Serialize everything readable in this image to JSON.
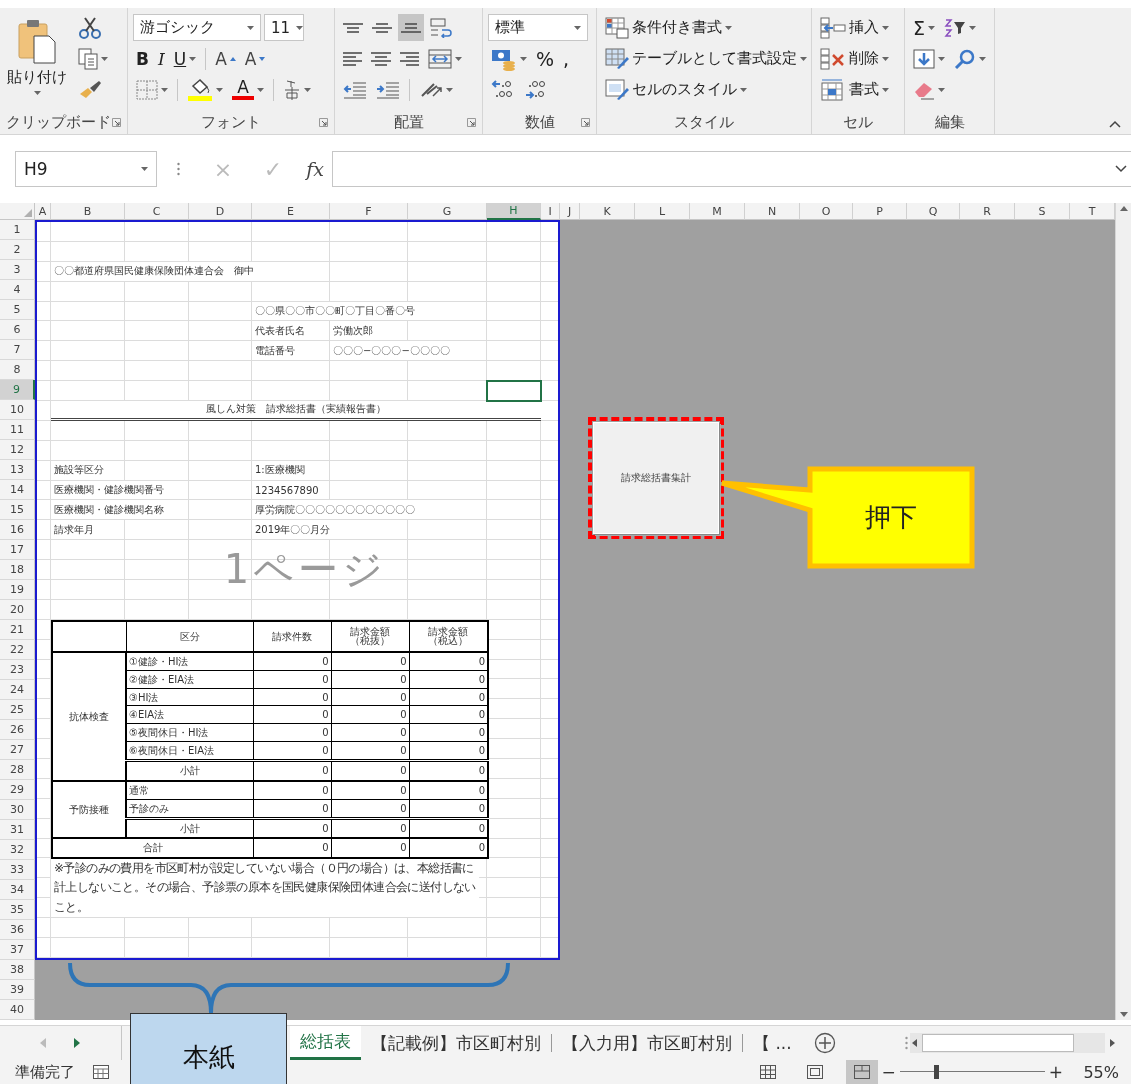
{
  "ribbon": {
    "clipboard": {
      "label": "クリップボード",
      "paste": "貼り付け"
    },
    "font": {
      "label": "フォント",
      "name": "游ゴシック",
      "size": "11",
      "bold": "B",
      "italic": "I",
      "underline": "U",
      "grow": "A",
      "shrink": "A",
      "color_letter": "A"
    },
    "alignment": {
      "label": "配置",
      "vertical": [
        {
          "kind": "top",
          "selected": false
        },
        {
          "kind": "middle",
          "selected": false
        },
        {
          "kind": "bottom",
          "selected": true
        }
      ]
    },
    "number": {
      "label": "数値",
      "format": "標準",
      "percent": "%",
      "comma": ","
    },
    "styles": {
      "label": "スタイル",
      "commands": [
        {
          "kind": "conditional",
          "label": "条件付き書式"
        },
        {
          "kind": "table",
          "label": "テーブルとして書式設定"
        },
        {
          "kind": "cell",
          "label": "セルのスタイル"
        }
      ]
    },
    "cells": {
      "label": "セル",
      "commands": [
        {
          "kind": "insert",
          "label": "挿入"
        },
        {
          "kind": "delete",
          "label": "削除"
        },
        {
          "kind": "format",
          "label": "書式"
        }
      ]
    },
    "editing": {
      "label": "編集",
      "sum": "Σ"
    }
  },
  "formula_bar": {
    "name_box": "H9",
    "cancel": {
      "label": "×",
      "disabled": true
    },
    "enter": {
      "label": "✓",
      "disabled": true
    },
    "function": "fx"
  },
  "sheet": {
    "column_headers": [
      {
        "label": "A",
        "selected": false
      },
      {
        "label": "B",
        "selected": false
      },
      {
        "label": "C",
        "selected": false
      },
      {
        "label": "D",
        "selected": false
      },
      {
        "label": "E",
        "selected": false
      },
      {
        "label": "F",
        "selected": false
      },
      {
        "label": "G",
        "selected": false
      },
      {
        "label": "H",
        "selected": true
      },
      {
        "label": "I",
        "selected": false
      },
      {
        "label": "J",
        "selected": false
      },
      {
        "label": "K",
        "selected": false
      },
      {
        "label": "L",
        "selected": false
      },
      {
        "label": "M",
        "selected": false
      },
      {
        "label": "N",
        "selected": false
      },
      {
        "label": "O",
        "selected": false
      },
      {
        "label": "P",
        "selected": false
      },
      {
        "label": "Q",
        "selected": false
      },
      {
        "label": "R",
        "selected": false
      },
      {
        "label": "S",
        "selected": false
      },
      {
        "label": "T",
        "selected": false
      }
    ],
    "row_headers": [
      {
        "label": "1",
        "selected": false
      },
      {
        "label": "2",
        "selected": false
      },
      {
        "label": "3",
        "selected": false
      },
      {
        "label": "4",
        "selected": false
      },
      {
        "label": "5",
        "selected": false
      },
      {
        "label": "6",
        "selected": false
      },
      {
        "label": "7",
        "selected": false
      },
      {
        "label": "8",
        "selected": false
      },
      {
        "label": "9",
        "selected": true
      },
      {
        "label": "10",
        "selected": false
      },
      {
        "label": "11",
        "selected": false
      },
      {
        "label": "12",
        "selected": false
      },
      {
        "label": "13",
        "selected": false
      },
      {
        "label": "14",
        "selected": false
      },
      {
        "label": "15",
        "selected": false
      },
      {
        "label": "16",
        "selected": false
      },
      {
        "label": "17",
        "selected": false
      },
      {
        "label": "18",
        "selected": false
      },
      {
        "label": "19",
        "selected": false
      },
      {
        "label": "20",
        "selected": false
      },
      {
        "label": "21",
        "selected": false
      },
      {
        "label": "22",
        "selected": false
      },
      {
        "label": "23",
        "selected": false
      },
      {
        "label": "24",
        "selected": false
      },
      {
        "label": "25",
        "selected": false
      },
      {
        "label": "26",
        "selected": false
      },
      {
        "label": "27",
        "selected": false
      },
      {
        "label": "28",
        "selected": false
      },
      {
        "label": "29",
        "selected": false
      },
      {
        "label": "30",
        "selected": false
      },
      {
        "label": "31",
        "selected": false
      },
      {
        "label": "32",
        "selected": false
      },
      {
        "label": "33",
        "selected": false
      },
      {
        "label": "34",
        "selected": false
      },
      {
        "label": "35",
        "selected": false
      },
      {
        "label": "36",
        "selected": false
      },
      {
        "label": "37",
        "selected": false
      },
      {
        "label": "38",
        "selected": false
      },
      {
        "label": "39",
        "selected": false
      },
      {
        "label": "40",
        "selected": false
      }
    ],
    "addressee": "〇〇都道府県国民健康保険団体連合会　御中",
    "address": "〇〇県〇〇市〇〇町〇丁目〇番〇号",
    "representative": {
      "label": "代表者氏名",
      "value": "労働次郎"
    },
    "phone": {
      "label": "電話番号",
      "value": "〇〇〇−〇〇〇−〇〇〇〇"
    },
    "title": "風しん対策　請求総括書（実績報告書）",
    "fields": [
      {
        "label": "施設等区分",
        "value": "1:医療機関"
      },
      {
        "label": "医療機関・健診機関番号",
        "value": "1234567890"
      },
      {
        "label": "医療機関・健診機関名称",
        "value": "厚労病院〇〇〇〇〇〇〇〇〇〇〇〇"
      },
      {
        "label": "請求年月",
        "value": "2019年〇〇月分"
      }
    ],
    "page_label": "1ページ",
    "table": {
      "headers": [
        [
          "区分"
        ],
        [
          "請求件数"
        ],
        [
          "請求金額",
          "（税抜）"
        ],
        [
          "請求金額",
          "（税込）"
        ]
      ],
      "groups": [
        {
          "name": "抗体検査",
          "rows": [
            {
              "kind": "item",
              "label": "①健診・HI法",
              "values": [
                "0",
                "0",
                "0"
              ]
            },
            {
              "kind": "item",
              "label": "②健診・EIA法",
              "values": [
                "0",
                "0",
                "0"
              ]
            },
            {
              "kind": "item",
              "label": "③HI法",
              "values": [
                "0",
                "0",
                "0"
              ]
            },
            {
              "kind": "item",
              "label": "④EIA法",
              "values": [
                "0",
                "0",
                "0"
              ]
            },
            {
              "kind": "item",
              "label": "⑤夜間休日・HI法",
              "values": [
                "0",
                "0",
                "0"
              ]
            },
            {
              "kind": "item",
              "label": "⑥夜間休日・EIA法",
              "values": [
                "0",
                "0",
                "0"
              ]
            },
            {
              "kind": "subtotal",
              "label": "小計",
              "values": [
                "0",
                "0",
                "0"
              ]
            }
          ]
        },
        {
          "name": "予防接種",
          "rows": [
            {
              "kind": "item",
              "label": "通常",
              "values": [
                "0",
                "0",
                "0"
              ]
            },
            {
              "kind": "item",
              "label": "予診のみ",
              "values": [
                "0",
                "0",
                "0"
              ]
            },
            {
              "kind": "subtotal",
              "label": "小計",
              "values": [
                "0",
                "0",
                "0"
              ]
            }
          ]
        }
      ],
      "total": {
        "label": "合計",
        "values": [
          "0",
          "0",
          "0"
        ]
      }
    },
    "note": "※予診のみの費用を市区町村が設定していない場合（０円の場合）は、本総括書に計上しないこと。その場合、予診票の原本を国民健康保険団体連合会に送付しないこと。",
    "button": "請求総括書集計"
  },
  "sheet_tabs": {
    "nav": [
      {
        "kind": "prev",
        "disabled": true
      },
      {
        "kind": "next",
        "disabled": false
      }
    ],
    "tabs": [
      {
        "label": "総括表",
        "selected": true
      },
      {
        "label": "【記載例】市区町村別",
        "selected": false
      },
      {
        "label": "【入力用】市区町村別",
        "selected": false
      },
      {
        "label": "【 ...",
        "selected": false
      }
    ]
  },
  "status_bar": {
    "status": "準備完了",
    "views": [
      {
        "kind": "normal",
        "selected": false
      },
      {
        "kind": "page_layout",
        "selected": false
      },
      {
        "kind": "page_break",
        "selected": true
      }
    ],
    "zoom": {
      "minus": "−",
      "plus": "+",
      "level": 0.25,
      "value": "55%"
    }
  },
  "annotations": {
    "callout": "押下",
    "brace_label": "本紙"
  }
}
